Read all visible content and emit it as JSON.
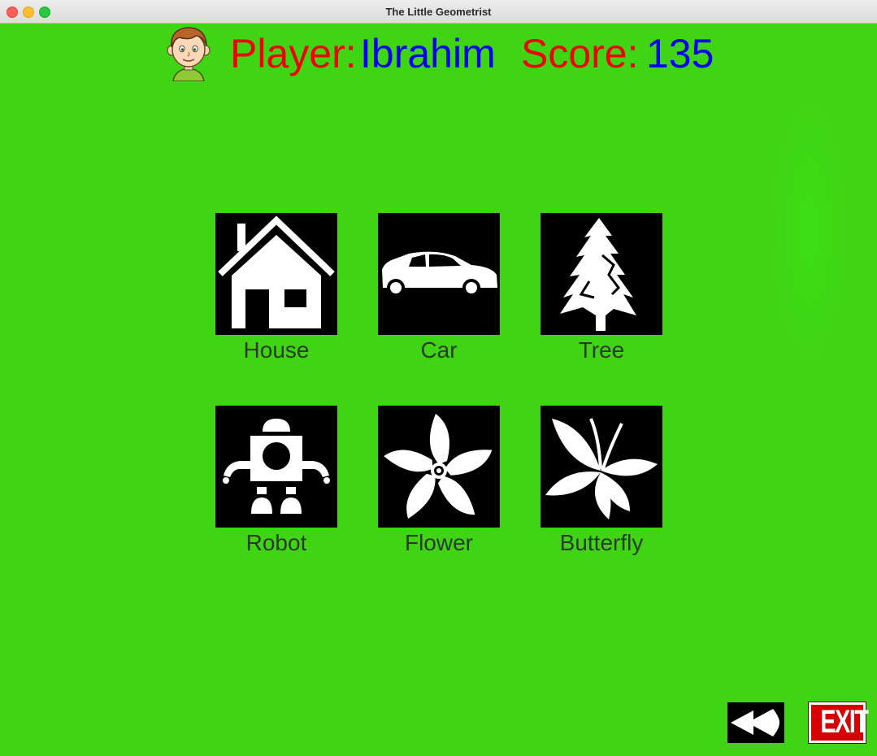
{
  "window": {
    "title": "The Little Geometrist"
  },
  "header": {
    "player_label": "Player:",
    "player_name": "Ibrahim",
    "score_label": "Score:",
    "score_value": "135",
    "avatar_icon": "boy-avatar-icon"
  },
  "colors": {
    "background": "#40d514",
    "label": "#f10000",
    "value": "#0000f0",
    "tile": "#000000",
    "exit_button": "#d70000"
  },
  "shapes": [
    {
      "label": "House",
      "icon": "house-icon"
    },
    {
      "label": "Car",
      "icon": "car-icon"
    },
    {
      "label": "Tree",
      "icon": "tree-icon"
    },
    {
      "label": "Robot",
      "icon": "robot-icon"
    },
    {
      "label": "Flower",
      "icon": "flower-icon"
    },
    {
      "label": "Butterfly",
      "icon": "butterfly-icon"
    }
  ],
  "nav": {
    "back_icon": "rewind-icon",
    "exit_label": "EXIT"
  }
}
